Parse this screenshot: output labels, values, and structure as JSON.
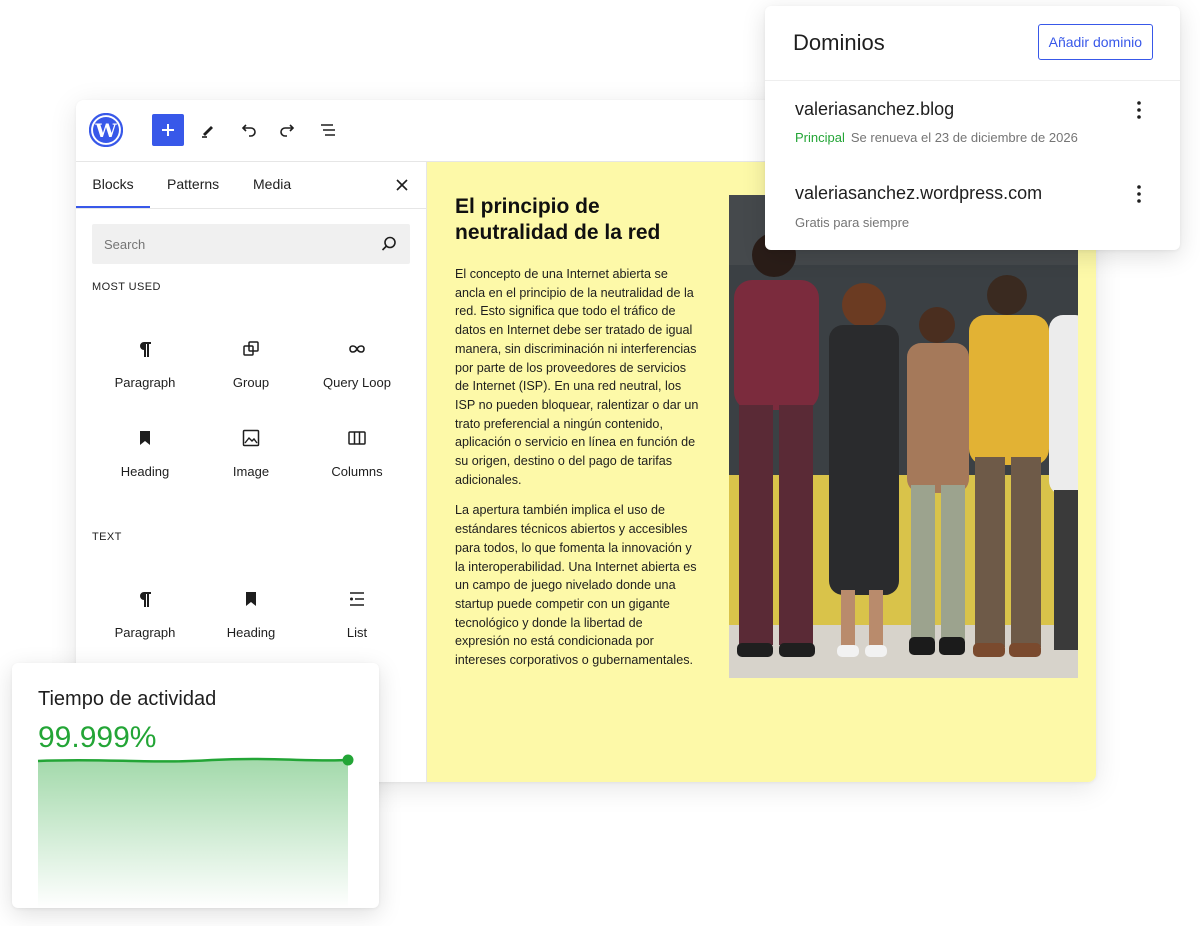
{
  "editor": {
    "toolbar": {
      "logo_icon": "wordpress-logo-icon",
      "add_icon": "plus-icon",
      "edit_icon": "pencil-icon",
      "undo_icon": "undo-icon",
      "redo_icon": "redo-icon",
      "outline_icon": "list-view-icon",
      "accent": "#3858e9"
    },
    "inserter": {
      "tabs": [
        {
          "label": "Blocks",
          "active": true
        },
        {
          "label": "Patterns",
          "active": false
        },
        {
          "label": "Media",
          "active": false
        }
      ],
      "close_icon": "close-icon",
      "search_placeholder": "Search",
      "sections": [
        {
          "title": "MOST USED",
          "blocks": [
            {
              "label": "Paragraph",
              "icon": "paragraph-icon"
            },
            {
              "label": "Group",
              "icon": "group-icon"
            },
            {
              "label": "Query Loop",
              "icon": "query-loop-icon"
            },
            {
              "label": "Heading",
              "icon": "heading-bookmark-icon"
            },
            {
              "label": "Image",
              "icon": "image-icon"
            },
            {
              "label": "Columns",
              "icon": "columns-icon"
            }
          ]
        },
        {
          "title": "TEXT",
          "blocks": [
            {
              "label": "Paragraph",
              "icon": "paragraph-icon"
            },
            {
              "label": "Heading",
              "icon": "heading-bookmark-icon"
            },
            {
              "label": "List",
              "icon": "list-icon"
            }
          ]
        }
      ]
    },
    "post": {
      "background": "#fdf9a8",
      "title": "El principio de neutralidad de la red",
      "paragraphs": [
        "El concepto de una Internet abierta se ancla en el principio de la neutralidad de la red. Esto significa que todo el tráfico de datos en Internet debe ser tratado de igual manera, sin discriminación ni interferencias por parte de los proveedores de servicios de Internet (ISP). En una red neutral, los ISP no pueden bloquear, ralentizar o dar un trato preferencial a ningún contenido, aplicación o servicio en línea en función de su origen, destino o del pago de tarifas adicionales.",
        "La apertura también implica el uso de estándares técnicos abiertos y accesibles para todos, lo que fomenta la innovación y la interoperabilidad. Una Internet abierta es un campo de juego nivelado donde una startup puede competir con un gigante tecnológico y donde la libertad de expresión no está condicionada por intereses corporativos o gubernamentales."
      ]
    }
  },
  "domains": {
    "title": "Dominios",
    "add_button": "Añadir dominio",
    "items": [
      {
        "name": "valeriasanchez.blog",
        "badge": "Principal",
        "status": "Se renueva el 23 de diciembre de 2026",
        "menu_icon": "more-vertical-icon"
      },
      {
        "name": "valeriasanchez.wordpress.com",
        "badge": "",
        "status": "Gratis para siempre",
        "menu_icon": "more-vertical-icon"
      }
    ],
    "badge_color": "#23a536"
  },
  "uptime": {
    "title": "Tiempo de actividad",
    "value": "99.999%",
    "color": "#23a536"
  }
}
